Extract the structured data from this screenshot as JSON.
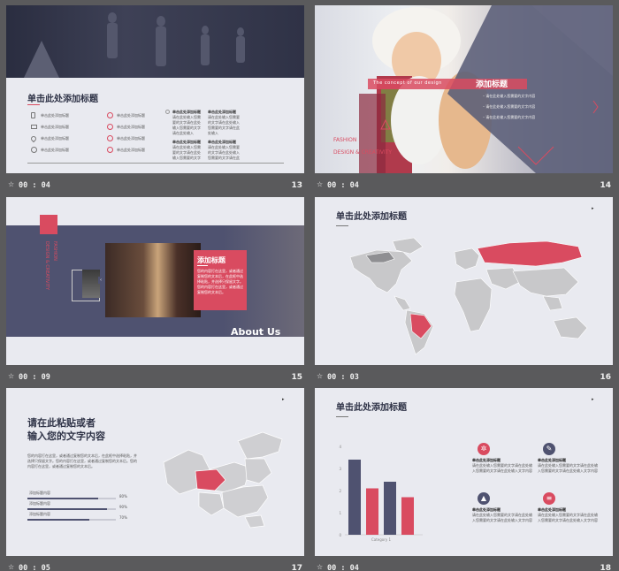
{
  "colors": {
    "accent": "#d94b60",
    "navy": "#4f5270",
    "bg": "#e9eaf0",
    "frame": "#5a5a5c"
  },
  "slides": [
    {
      "time": "00 : 04",
      "number": "13",
      "title": "单击此处添加标题",
      "items": [
        {
          "icon": "phone-icon",
          "text": "单击此处添加标题"
        },
        {
          "icon": "mail-icon",
          "text": "单击此处添加标题"
        },
        {
          "icon": "pin-icon",
          "text": "单击此处添加标题"
        },
        {
          "icon": "globe-icon",
          "text": "单击此处添加标题"
        }
      ],
      "items2": [
        {
          "icon": "link-icon",
          "text": "单击此处添加标题"
        },
        {
          "icon": "info-icon",
          "text": "单击此处添加标题"
        },
        {
          "icon": "alert-icon",
          "text": "单击此处添加标题"
        },
        {
          "icon": "user-icon",
          "text": "单击此处添加标题"
        }
      ],
      "cols": [
        {
          "heading": "单击此处添加标题",
          "body": "请在此处输入您需要的文字请在此处输入您需要的文字请在此处输入"
        },
        {
          "heading": "单击此处添加标题",
          "body": "请在此处输入您需要的文字请在此处输入您需要的文字请在此处输入"
        },
        {
          "heading": "单击此处添加标题",
          "body": "请在此处输入您需要的文字请在此处输入您需要的文字请在此处输入"
        },
        {
          "heading": "单击此处添加标题",
          "body": "请在此处输入您需要的文字请在此处输入您需要的文字请在此处输入"
        }
      ]
    },
    {
      "time": "00 : 04",
      "number": "14",
      "concept": "The concept of our design",
      "title": "添加标题",
      "bullets": [
        "请在此处输入您需要的文字内容",
        "请在此处输入您需要的文字内容",
        "请在此处输入您需要的文字内容"
      ],
      "fashion": "FASHION",
      "design": "DESIGN & CREATIVITY"
    },
    {
      "time": "00 : 09",
      "number": "15",
      "fashion_v": "FASHION",
      "design_v": "DESIGN & CREATIVITY",
      "title": "添加标题",
      "body": "您的内容打在这里，或者通过复制您的文本后，在此框中选择粘贴，并选择只保留文字。您的内容打在这里，或者通过复制您的文本后。",
      "about": "About Us"
    },
    {
      "time": "00 : 03",
      "number": "16",
      "title": "单击此处添加标题"
    },
    {
      "time": "00 : 05",
      "number": "17",
      "title_line1": "请在此粘贴或者",
      "title_line2": "输入您的文字内容",
      "body": "您的内容打在这里，或者通过复制您的文本后，在此框中选择粘贴，并选择只保留文字。您的内容打在这里，或者通过复制您的文本后。您的内容打在这里，或者通过复制您的文本后。",
      "bars": [
        {
          "label": "添加标题内容",
          "percent": "80%",
          "value": 0.8
        },
        {
          "label": "添加标题内容",
          "percent": "90%",
          "value": 0.9
        },
        {
          "label": "添加标题内容",
          "percent": "70%",
          "value": 0.7
        }
      ]
    },
    {
      "time": "00 : 04",
      "number": "18",
      "title": "单击此处添加标题",
      "cards": [
        {
          "icon": "sun-icon",
          "heading": "单击此处添加标题",
          "body": "请在此处输入您需要的文字请在此处输入您需要的文字请在此处输入文字内容"
        },
        {
          "icon": "pen-icon",
          "heading": "单击此处添加标题",
          "body": "请在此处输入您需要的文字请在此处输入您需要的文字请在此处输入文字内容"
        },
        {
          "icon": "tree-icon",
          "heading": "单击此处添加标题",
          "body": "请在此处输入您需要的文字请在此处输入您需要的文字请在此处输入文字内容"
        },
        {
          "icon": "layers-icon",
          "heading": "单击此处添加标题",
          "body": "请在此处输入您需要的文字请在此处输入您需要的文字请在此处输入文字内容"
        }
      ],
      "chart_data": {
        "type": "bar",
        "categories": [
          "1",
          "2",
          "3",
          "4"
        ],
        "values": [
          3.4,
          2.1,
          2.4,
          1.7
        ],
        "ylim": [
          0,
          4
        ],
        "yticks": [
          "0",
          "1",
          "2",
          "3",
          "4"
        ],
        "xlabel": "Category 1",
        "colors": [
          "#4f5270",
          "#d94b60",
          "#4f5270",
          "#d94b60"
        ]
      }
    }
  ]
}
